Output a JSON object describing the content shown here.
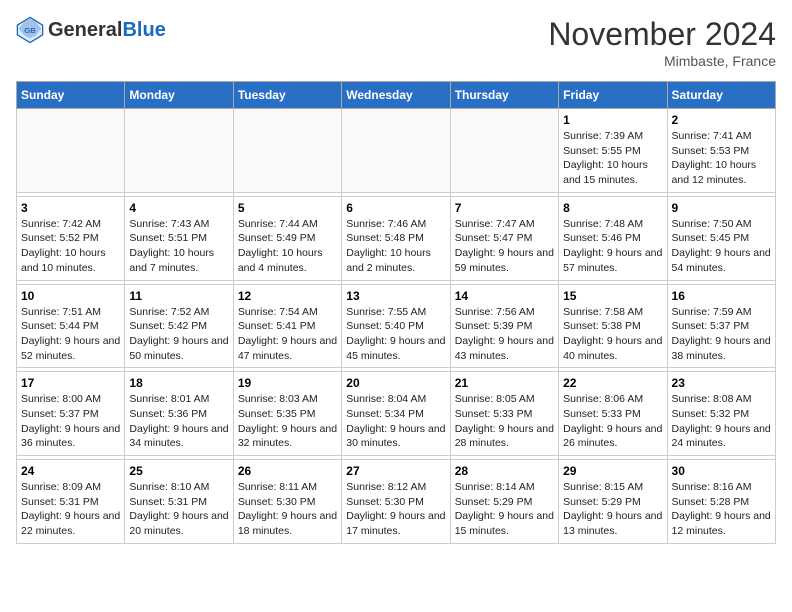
{
  "header": {
    "logo_general": "General",
    "logo_blue": "Blue",
    "month_title": "November 2024",
    "location": "Mimbaste, France"
  },
  "days_of_week": [
    "Sunday",
    "Monday",
    "Tuesday",
    "Wednesday",
    "Thursday",
    "Friday",
    "Saturday"
  ],
  "weeks": [
    [
      {
        "day": "",
        "info": ""
      },
      {
        "day": "",
        "info": ""
      },
      {
        "day": "",
        "info": ""
      },
      {
        "day": "",
        "info": ""
      },
      {
        "day": "",
        "info": ""
      },
      {
        "day": "1",
        "info": "Sunrise: 7:39 AM\nSunset: 5:55 PM\nDaylight: 10 hours and 15 minutes."
      },
      {
        "day": "2",
        "info": "Sunrise: 7:41 AM\nSunset: 5:53 PM\nDaylight: 10 hours and 12 minutes."
      }
    ],
    [
      {
        "day": "3",
        "info": "Sunrise: 7:42 AM\nSunset: 5:52 PM\nDaylight: 10 hours and 10 minutes."
      },
      {
        "day": "4",
        "info": "Sunrise: 7:43 AM\nSunset: 5:51 PM\nDaylight: 10 hours and 7 minutes."
      },
      {
        "day": "5",
        "info": "Sunrise: 7:44 AM\nSunset: 5:49 PM\nDaylight: 10 hours and 4 minutes."
      },
      {
        "day": "6",
        "info": "Sunrise: 7:46 AM\nSunset: 5:48 PM\nDaylight: 10 hours and 2 minutes."
      },
      {
        "day": "7",
        "info": "Sunrise: 7:47 AM\nSunset: 5:47 PM\nDaylight: 9 hours and 59 minutes."
      },
      {
        "day": "8",
        "info": "Sunrise: 7:48 AM\nSunset: 5:46 PM\nDaylight: 9 hours and 57 minutes."
      },
      {
        "day": "9",
        "info": "Sunrise: 7:50 AM\nSunset: 5:45 PM\nDaylight: 9 hours and 54 minutes."
      }
    ],
    [
      {
        "day": "10",
        "info": "Sunrise: 7:51 AM\nSunset: 5:44 PM\nDaylight: 9 hours and 52 minutes."
      },
      {
        "day": "11",
        "info": "Sunrise: 7:52 AM\nSunset: 5:42 PM\nDaylight: 9 hours and 50 minutes."
      },
      {
        "day": "12",
        "info": "Sunrise: 7:54 AM\nSunset: 5:41 PM\nDaylight: 9 hours and 47 minutes."
      },
      {
        "day": "13",
        "info": "Sunrise: 7:55 AM\nSunset: 5:40 PM\nDaylight: 9 hours and 45 minutes."
      },
      {
        "day": "14",
        "info": "Sunrise: 7:56 AM\nSunset: 5:39 PM\nDaylight: 9 hours and 43 minutes."
      },
      {
        "day": "15",
        "info": "Sunrise: 7:58 AM\nSunset: 5:38 PM\nDaylight: 9 hours and 40 minutes."
      },
      {
        "day": "16",
        "info": "Sunrise: 7:59 AM\nSunset: 5:37 PM\nDaylight: 9 hours and 38 minutes."
      }
    ],
    [
      {
        "day": "17",
        "info": "Sunrise: 8:00 AM\nSunset: 5:37 PM\nDaylight: 9 hours and 36 minutes."
      },
      {
        "day": "18",
        "info": "Sunrise: 8:01 AM\nSunset: 5:36 PM\nDaylight: 9 hours and 34 minutes."
      },
      {
        "day": "19",
        "info": "Sunrise: 8:03 AM\nSunset: 5:35 PM\nDaylight: 9 hours and 32 minutes."
      },
      {
        "day": "20",
        "info": "Sunrise: 8:04 AM\nSunset: 5:34 PM\nDaylight: 9 hours and 30 minutes."
      },
      {
        "day": "21",
        "info": "Sunrise: 8:05 AM\nSunset: 5:33 PM\nDaylight: 9 hours and 28 minutes."
      },
      {
        "day": "22",
        "info": "Sunrise: 8:06 AM\nSunset: 5:33 PM\nDaylight: 9 hours and 26 minutes."
      },
      {
        "day": "23",
        "info": "Sunrise: 8:08 AM\nSunset: 5:32 PM\nDaylight: 9 hours and 24 minutes."
      }
    ],
    [
      {
        "day": "24",
        "info": "Sunrise: 8:09 AM\nSunset: 5:31 PM\nDaylight: 9 hours and 22 minutes."
      },
      {
        "day": "25",
        "info": "Sunrise: 8:10 AM\nSunset: 5:31 PM\nDaylight: 9 hours and 20 minutes."
      },
      {
        "day": "26",
        "info": "Sunrise: 8:11 AM\nSunset: 5:30 PM\nDaylight: 9 hours and 18 minutes."
      },
      {
        "day": "27",
        "info": "Sunrise: 8:12 AM\nSunset: 5:30 PM\nDaylight: 9 hours and 17 minutes."
      },
      {
        "day": "28",
        "info": "Sunrise: 8:14 AM\nSunset: 5:29 PM\nDaylight: 9 hours and 15 minutes."
      },
      {
        "day": "29",
        "info": "Sunrise: 8:15 AM\nSunset: 5:29 PM\nDaylight: 9 hours and 13 minutes."
      },
      {
        "day": "30",
        "info": "Sunrise: 8:16 AM\nSunset: 5:28 PM\nDaylight: 9 hours and 12 minutes."
      }
    ]
  ]
}
